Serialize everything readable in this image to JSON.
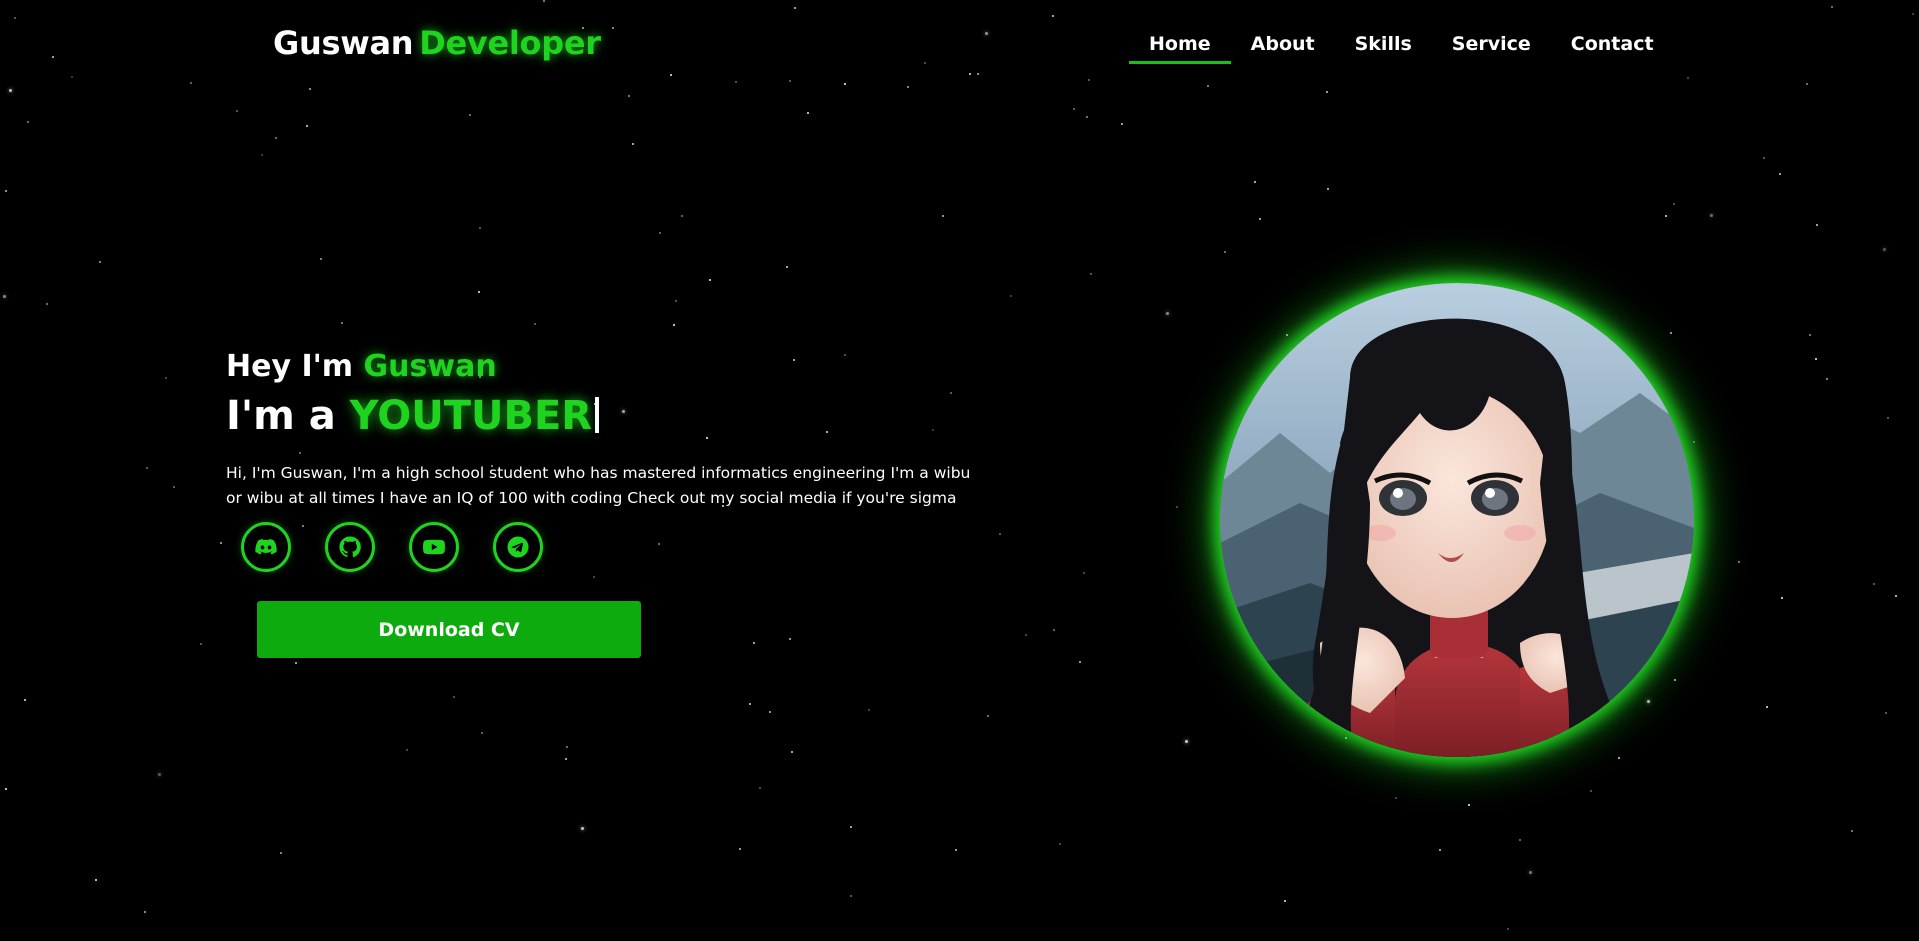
{
  "header": {
    "logo_name": "Guswan",
    "logo_accent": "Developer",
    "nav": [
      {
        "label": "Home",
        "active": true
      },
      {
        "label": "About",
        "active": false
      },
      {
        "label": "Skills",
        "active": false
      },
      {
        "label": "Service",
        "active": false
      },
      {
        "label": "Contact",
        "active": false
      }
    ]
  },
  "hero": {
    "greeting_prefix": "Hey I'm",
    "greeting_name": "Guswan",
    "role_prefix": "I'm a",
    "role_word": "YOUTUBER",
    "bio_line1": "Hi, I'm Guswan, I'm a high school student who has mastered informatics engineering I'm a wibu",
    "bio_line2": "or wibu at all times I have an IQ of 100 with coding Check out my social media if you're sigma",
    "socials": [
      {
        "icon": "discord-icon"
      },
      {
        "icon": "github-icon"
      },
      {
        "icon": "youtube-icon"
      },
      {
        "icon": "telegram-icon"
      }
    ],
    "cv_button_label": "Download CV"
  },
  "colors": {
    "accent": "#1fd41f",
    "button": "#0eab0e",
    "background": "#000000"
  }
}
